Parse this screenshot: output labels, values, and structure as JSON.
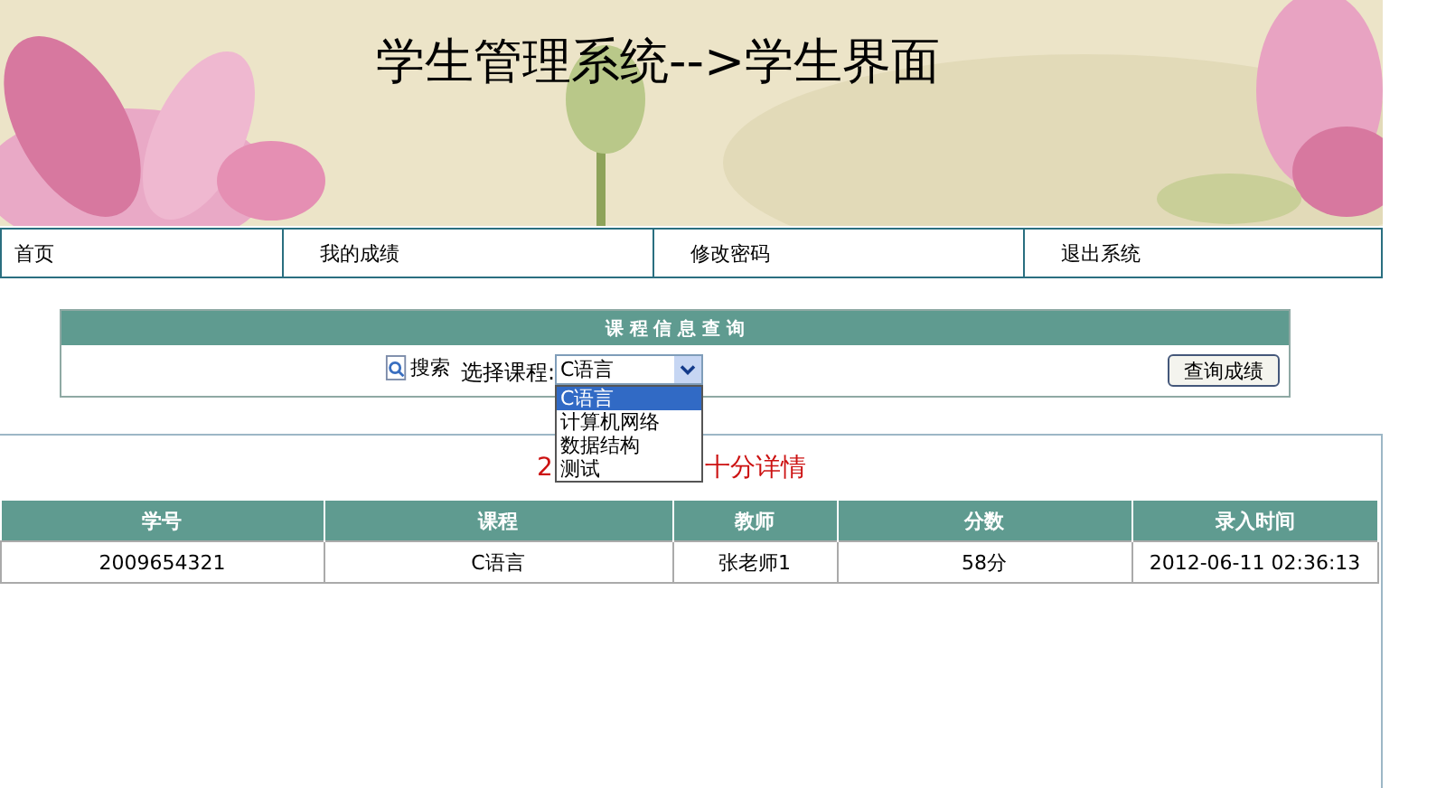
{
  "banner": {
    "title": "学生管理系统-->学生界面"
  },
  "nav": {
    "items": [
      {
        "label": "首页"
      },
      {
        "label": "我的成绩"
      },
      {
        "label": "修改密码"
      },
      {
        "label": "退出系统"
      }
    ]
  },
  "query_panel": {
    "title": "课 程 信 息 查 询",
    "search_label": "搜索",
    "course_label": "选择课程:",
    "course_value": "C语言",
    "options": [
      {
        "label": "C语言",
        "selected": true
      },
      {
        "label": "计算机网络",
        "selected": false
      },
      {
        "label": "数据结构",
        "selected": false
      },
      {
        "label": "测试",
        "selected": false
      }
    ],
    "button": "查询成绩"
  },
  "results": {
    "heading_parts": [
      "2",
      "十分详情"
    ],
    "table": {
      "columns": [
        "学号",
        "课程",
        "教师",
        "分数",
        "录入时间"
      ],
      "rows": [
        [
          "2009654321",
          "C语言",
          "张老师1",
          "58分",
          "2012-06-11 02:36:13"
        ]
      ]
    }
  }
}
